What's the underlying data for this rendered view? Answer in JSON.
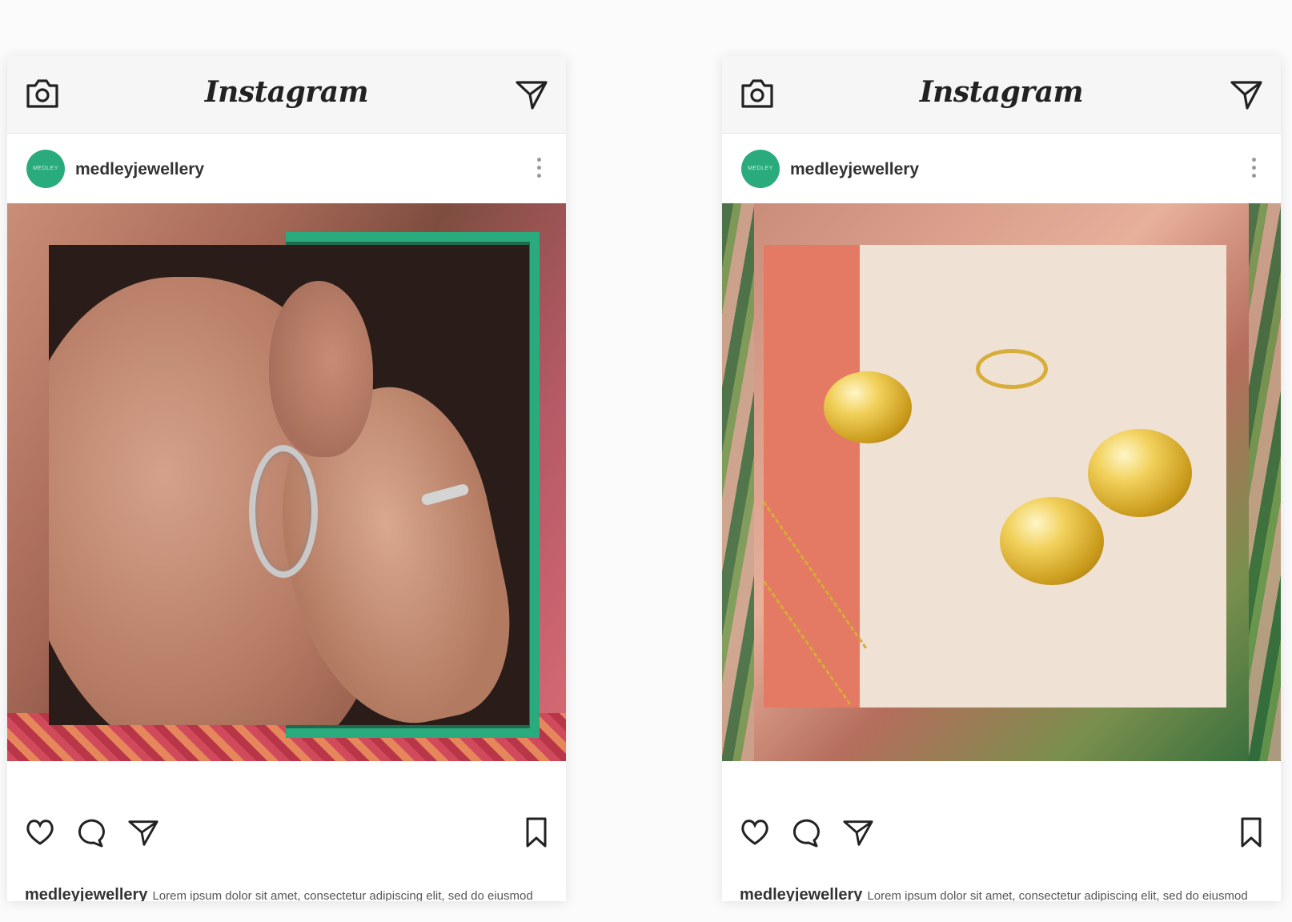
{
  "app": {
    "name": "Instagram"
  },
  "posts": [
    {
      "username": "medleyjewellery",
      "avatar_text": "MEDLEY",
      "caption_user": "medleyjewellery",
      "caption_text": "Lorem ipsum dolor sit amet, consectetur adipiscing elit, sed do eiusmod tempor incididunt ut labore et dolore magna aliqua."
    },
    {
      "username": "medleyjewellery",
      "avatar_text": "MEDLEY",
      "caption_user": "medleyjewellery",
      "caption_text": "Lorem ipsum dolor sit amet, consectetur adipiscing elit, sed do eiusmod tempor incididunt ut labore et dolore magna aliqua."
    }
  ],
  "icons": [
    "camera-icon",
    "send-icon",
    "more-icon",
    "heart-icon",
    "comment-icon",
    "share-icon",
    "bookmark-icon"
  ],
  "colors": {
    "brand_green": "#2aab7d",
    "coral": "#e47a63",
    "topbar": "#f6f6f6"
  }
}
